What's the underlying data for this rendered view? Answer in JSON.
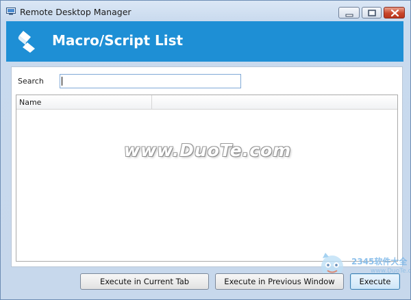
{
  "window": {
    "title": "Remote Desktop Manager",
    "controls": [
      "minimize",
      "maximize",
      "close"
    ]
  },
  "header": {
    "title": "Macro/Script List",
    "icon": "script-scroll-icon",
    "color": "#1e8fd5"
  },
  "search": {
    "label": "Search",
    "value": "",
    "placeholder": ""
  },
  "list": {
    "columns": [
      "Name",
      ""
    ],
    "rows": []
  },
  "watermark": {
    "text": "www.DuoTe.com"
  },
  "corner_logo": {
    "text": "2345软件大全",
    "url": "www.DuoTe.com"
  },
  "buttons": {
    "execute_current": "Execute in Current Tab",
    "execute_previous": "Execute in Previous Window",
    "execute": "Execute"
  }
}
